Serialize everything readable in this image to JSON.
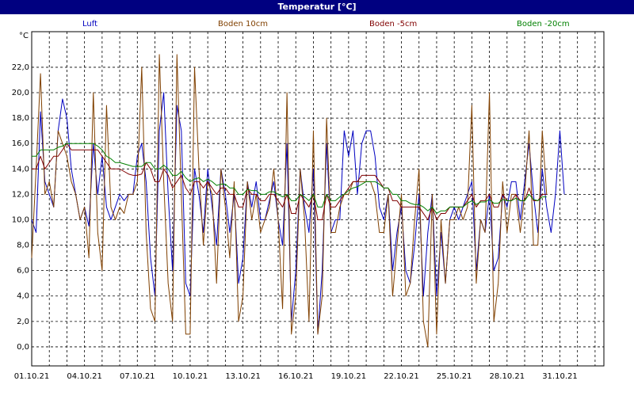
{
  "window": {
    "title": "Temperatur [°C]"
  },
  "chart_data": {
    "type": "line",
    "title": "Temperatur [°C]",
    "ylabel": "°C",
    "xlabel": "",
    "ylim": [
      -1.5,
      24.8
    ],
    "xlim": [
      "01.10.21",
      "02.11.21"
    ],
    "grid": true,
    "legend_position": "top",
    "yticks": [
      0,
      2,
      4,
      6,
      8,
      10,
      12,
      14,
      16,
      18,
      20,
      22
    ],
    "ytick_labels": [
      "0,0",
      "2,0",
      "4,0",
      "6,0",
      "8,0",
      "10,0",
      "12,0",
      "14,0",
      "16,0",
      "18,0",
      "20,0",
      "22,0"
    ],
    "xticks": [
      0,
      3,
      6,
      9,
      12,
      15,
      18,
      21,
      24,
      27,
      30
    ],
    "xtick_labels": [
      "01.10.21",
      "04.10.21",
      "07.10.21",
      "10.10.21",
      "13.10.21",
      "16.10.21",
      "19.10.21",
      "22.10.21",
      "25.10.21",
      "28.10.21",
      "31.10.21"
    ],
    "x_days": [
      0,
      0.25,
      0.5,
      0.75,
      1,
      1.25,
      1.5,
      1.75,
      2,
      2.25,
      2.5,
      2.75,
      3,
      3.25,
      3.5,
      3.75,
      4,
      4.25,
      4.5,
      4.75,
      5,
      5.25,
      5.5,
      5.75,
      6,
      6.25,
      6.5,
      6.75,
      7,
      7.25,
      7.5,
      7.75,
      8,
      8.25,
      8.5,
      8.75,
      9,
      9.25,
      9.5,
      9.75,
      10,
      10.25,
      10.5,
      10.75,
      11,
      11.25,
      11.5,
      11.75,
      12,
      12.25,
      12.5,
      12.75,
      13,
      13.25,
      13.5,
      13.75,
      14,
      14.25,
      14.5,
      14.75,
      15,
      15.25,
      15.5,
      15.75,
      16,
      16.25,
      16.5,
      16.75,
      17,
      17.25,
      17.5,
      17.75,
      18,
      18.25,
      18.5,
      18.75,
      19,
      19.25,
      19.5,
      19.75,
      20,
      20.25,
      20.5,
      20.75,
      21,
      21.25,
      21.5,
      21.75,
      22,
      22.25,
      22.5,
      22.75,
      23,
      23.25,
      23.5,
      23.75,
      24,
      24.25,
      24.5,
      24.75,
      25,
      25.25,
      25.5,
      25.75,
      26,
      26.25,
      26.5,
      26.75,
      27,
      27.25,
      27.5,
      27.75,
      28,
      28.25,
      28.5,
      28.75,
      29,
      29.25,
      29.5,
      29.75,
      30,
      30.25,
      30.5,
      30.75,
      31,
      31.25,
      31.5,
      31.75,
      32
    ],
    "series": [
      {
        "name": "Luft",
        "color": "#0000c0",
        "values": [
          10,
          9,
          18.5,
          13,
          12,
          11,
          17,
          19.5,
          18,
          14,
          12,
          10,
          11,
          9.5,
          16,
          12,
          15,
          11,
          10,
          11,
          12,
          11.5,
          12,
          12,
          15,
          16,
          13,
          7,
          4,
          17,
          20,
          12,
          6,
          19,
          17,
          5,
          4,
          14,
          12,
          9,
          14,
          11,
          8,
          14,
          12,
          9,
          12,
          5,
          7,
          13,
          11,
          13,
          10,
          10,
          11.5,
          13,
          10,
          8,
          16,
          2,
          6,
          14,
          11,
          9,
          14,
          1,
          6,
          16,
          9,
          10,
          10,
          17,
          15,
          17,
          12,
          16,
          17,
          17,
          15,
          11,
          10,
          12,
          6,
          9,
          11,
          6,
          5,
          8,
          12,
          4,
          9,
          12,
          4,
          9,
          5,
          10,
          11,
          10,
          11,
          12,
          13,
          6,
          10,
          9,
          12,
          6,
          7,
          12,
          11,
          13,
          13,
          10,
          13,
          16,
          12,
          9,
          14,
          11,
          9,
          12,
          17,
          12
        ]
      },
      {
        "name": "Boden 10cm",
        "color": "#804000",
        "values": [
          7,
          14,
          21.5,
          12,
          13,
          11,
          17,
          16,
          15,
          13,
          12,
          10,
          11,
          7,
          20,
          9,
          6,
          19,
          11,
          10,
          11,
          10.5,
          12,
          12,
          13,
          22,
          9,
          3,
          2,
          23,
          13,
          5,
          2,
          23,
          12,
          1,
          1,
          22,
          14,
          8,
          13,
          12,
          5,
          14,
          11,
          7,
          13,
          2,
          4,
          13,
          10,
          12,
          9,
          10,
          11,
          14,
          10,
          3,
          20,
          1,
          4,
          14,
          10,
          2,
          17,
          1,
          4,
          18,
          9,
          9,
          11,
          12,
          12,
          13,
          13,
          13,
          13,
          13,
          12,
          9,
          9,
          12,
          4,
          8,
          12,
          4,
          5,
          10,
          14,
          2,
          0,
          12,
          1,
          10,
          5,
          10,
          10,
          11,
          10,
          11,
          19,
          5,
          10,
          9,
          20,
          2,
          5,
          13,
          9,
          12,
          12,
          9,
          12,
          17,
          8,
          8,
          17,
          12
        ]
      },
      {
        "name": "Boden -5cm",
        "color": "#800000",
        "values": [
          14,
          14,
          15,
          14,
          14.5,
          15,
          15,
          15.5,
          16,
          15.5,
          15.5,
          15.5,
          15.5,
          15.5,
          15.5,
          15.5,
          15,
          14.5,
          14,
          14,
          14,
          13.8,
          13.6,
          13.5,
          13.5,
          13.6,
          14.5,
          14,
          13,
          13,
          14,
          13.5,
          12.5,
          13,
          13.5,
          12.5,
          12,
          13,
          13,
          12.5,
          13,
          12.5,
          12,
          12.5,
          12.5,
          12,
          12,
          11,
          11,
          12.5,
          12,
          12,
          11.5,
          11.5,
          12,
          12,
          11.5,
          11,
          12,
          10.5,
          10.5,
          12,
          11.5,
          11,
          12,
          10,
          10,
          12,
          11,
          11,
          11.5,
          12,
          12.5,
          13,
          13,
          13.5,
          13.5,
          13.5,
          13.5,
          13,
          12.5,
          12.5,
          11.5,
          11.5,
          11,
          11,
          11,
          11,
          11,
          10.5,
          10,
          11,
          10,
          10.5,
          10.5,
          11,
          11,
          11,
          11,
          11.5,
          12,
          11,
          11.5,
          11.5,
          12,
          11,
          11,
          12,
          11.5,
          11.5,
          12,
          11.5,
          11.5,
          12.5,
          11.5,
          11.5,
          12,
          12
        ]
      },
      {
        "name": "Boden -20cm",
        "color": "#008000",
        "values": [
          15,
          15,
          15.5,
          15.5,
          15.5,
          15.5,
          15.7,
          15.8,
          16,
          16,
          16,
          16,
          16,
          16,
          16,
          15.8,
          15.5,
          15,
          14.8,
          14.5,
          14.5,
          14.4,
          14.3,
          14.2,
          14.2,
          14.2,
          14.5,
          14.5,
          14,
          14,
          14.3,
          14,
          13.5,
          13.5,
          13.8,
          13.3,
          13,
          13.2,
          13.3,
          13,
          13.2,
          13,
          12.7,
          12.8,
          12.8,
          12.5,
          12.5,
          12,
          12,
          12.4,
          12.3,
          12.3,
          12,
          12,
          12.2,
          12.2,
          12,
          11.8,
          12,
          11.5,
          11.5,
          12,
          11.8,
          11.5,
          12,
          11,
          11,
          12,
          11.5,
          11.5,
          11.8,
          12,
          12.3,
          12.5,
          12.6,
          12.8,
          13,
          13,
          13,
          12.8,
          12.5,
          12.5,
          12,
          12,
          11.5,
          11.5,
          11.3,
          11.2,
          11.2,
          11,
          10.7,
          11,
          10.5,
          10.7,
          10.7,
          11,
          11,
          11,
          11,
          11.3,
          11.5,
          11.2,
          11.4,
          11.4,
          11.6,
          11.3,
          11.3,
          11.6,
          11.5,
          11.5,
          11.7,
          11.5,
          11.5,
          12,
          11.6,
          11.5,
          11.8,
          11.8
        ]
      }
    ]
  }
}
